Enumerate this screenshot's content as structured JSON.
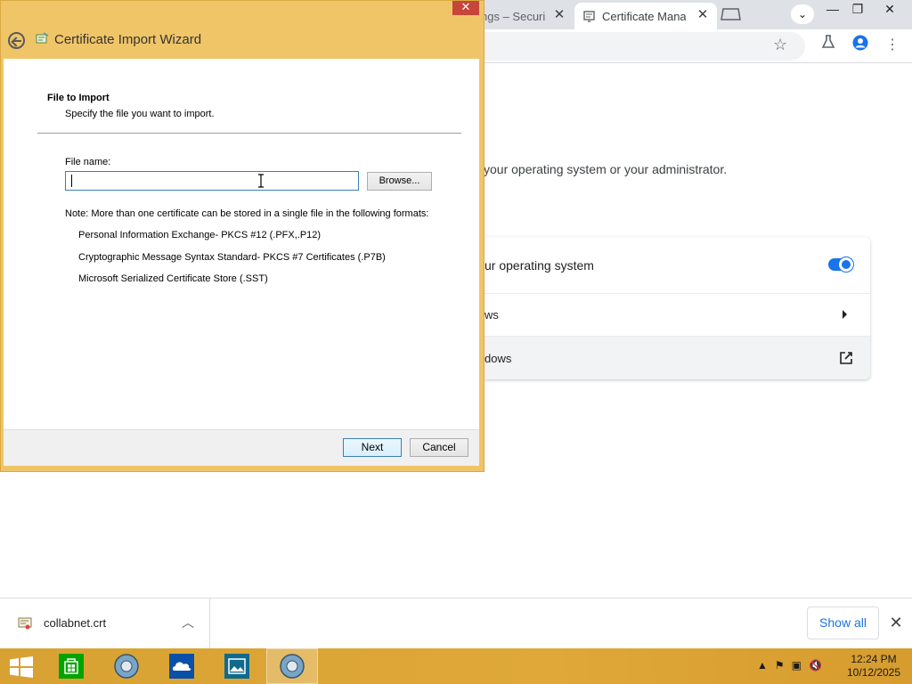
{
  "browser": {
    "tabs": [
      {
        "title": "ngs – Securit",
        "active": false
      },
      {
        "title": "Certificate Manag",
        "active": true
      }
    ],
    "window_controls": {
      "minimize": "—",
      "restore": "❐",
      "close": "✕"
    }
  },
  "settings_page": {
    "description": "your operating system or your administrator.",
    "rows": [
      {
        "label": "ur operating system",
        "control": "toggle",
        "on": true
      },
      {
        "label": "ws",
        "control": "arrow"
      },
      {
        "label": "dows",
        "control": "external-link"
      }
    ]
  },
  "dialog": {
    "title": "Certificate Import Wizard",
    "close_label": "✕",
    "section_title": "File to Import",
    "section_desc": "Specify the file you want to import.",
    "file_name_label": "File name:",
    "file_name_value": "",
    "browse_label": "Browse...",
    "note": "Note:  More than one certificate can be stored in a single file in the following formats:",
    "formats": [
      "Personal Information Exchange- PKCS #12 (.PFX,.P12)",
      "Cryptographic Message Syntax Standard- PKCS #7 Certificates (.P7B)",
      "Microsoft Serialized Certificate Store (.SST)"
    ],
    "next_label": "Next",
    "cancel_label": "Cancel"
  },
  "downloads": {
    "file_name": "collabnet.crt",
    "show_all": "Show all"
  },
  "taskbar": {
    "time": "12:24 PM",
    "date": "10/12/2025"
  },
  "colors": {
    "dialog_frame": "#f0c568",
    "taskbar": "#dfa838",
    "accent": "#1a73e8"
  }
}
